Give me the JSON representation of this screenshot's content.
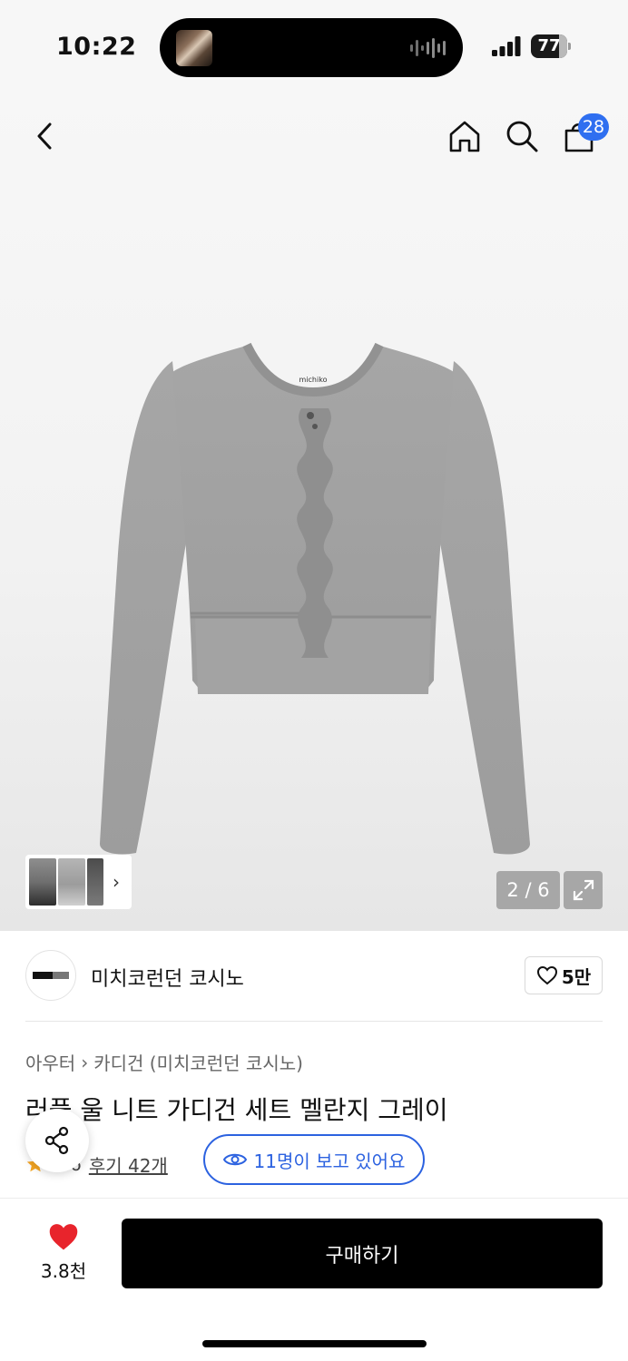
{
  "status_bar": {
    "time": "10:22",
    "battery": "77",
    "battery_level": 0.77
  },
  "header": {
    "back_icon": "chevron-left-icon",
    "home_icon": "home-icon",
    "search_icon": "search-icon",
    "cart_icon": "shopping-bag-icon",
    "cart_count": "28"
  },
  "gallery": {
    "page_counter": "2 / 6",
    "thumb_chevron": "›",
    "product_label": "michiko"
  },
  "brand": {
    "name": "미치코런던 코시노",
    "likes": "5만"
  },
  "product": {
    "breadcrumb": [
      "아우터",
      "카디건 (미치코런던 코시노)"
    ],
    "breadcrumb_sep": "›",
    "title": "러플 울 니트 가디건 세트 멜란지 그레이",
    "rating": "4.6",
    "reviews": "후기 42개",
    "viewers": "11명이 보고 있어요"
  },
  "bottom": {
    "wish_count": "3.8천",
    "buy_label": "구매하기"
  },
  "colors": {
    "accent_blue": "#2c62e0",
    "badge_blue": "#2f6ff0",
    "heart_red": "#e8242c",
    "star_yellow": "#f5a623"
  }
}
